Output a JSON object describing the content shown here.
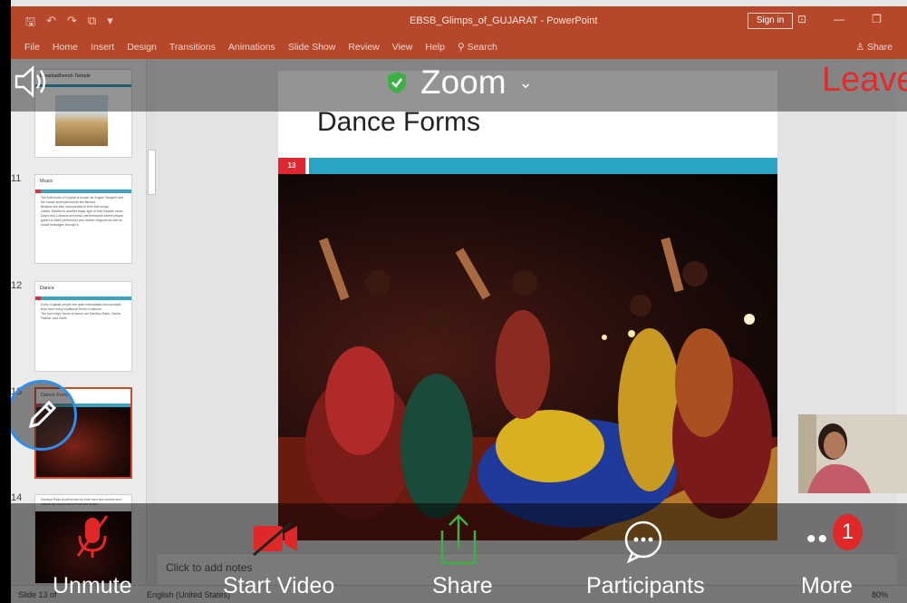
{
  "ppt": {
    "title": "EBSB_Glimps_of_GUJARAT - PowerPoint",
    "sign_in": "Sign in",
    "ribbon_tabs": [
      "File",
      "Home",
      "Insert",
      "Design",
      "Transitions",
      "Animations",
      "Slide Show",
      "Review",
      "View",
      "Help",
      "Search"
    ],
    "share": "Share",
    "notes_placeholder": "Click to add notes",
    "status_left": "Slide 13 of",
    "status_lang": "English (United States)",
    "zoom_level": "80%"
  },
  "thumbnails": [
    {
      "num": "",
      "title": "Dwarkadheesh Temple"
    },
    {
      "num": "11",
      "title": "Music",
      "lines": [
        "The folk music of Gujarat is known as Sugam Sangeet and the vocals and instruments are famous.",
        "Bhajans are also incorporated in their folk songs.",
        "Garba, Haldhin is another major type of folk Gujarati music.",
        "Dayro and Lokvarta are music performances where people gather to listen performers who deliver religious as well as social messages through it."
      ]
    },
    {
      "num": "12",
      "title": "Dance",
      "lines": [
        "Every Gujarati people are quite enthusiastic and sociable, thus have many traditional forms of dances.",
        "The four major forms of dance are Dandiya Raas, Garba, Padhar, and Garbi."
      ]
    },
    {
      "num": "13",
      "title": "Dance Forms"
    },
    {
      "num": "14",
      "title": "Dandiya Raas is performed by both men and women and reflects the movement of feminine charm..."
    }
  ],
  "slide": {
    "title": "Dance Forms",
    "number": "13"
  },
  "zoom": {
    "app_name": "Zoom",
    "leave": "Leave",
    "controls": {
      "unmute": "Unmute",
      "start_video": "Start Video",
      "share": "Share",
      "participants": "Participants",
      "more": "More"
    },
    "more_badge": "1"
  },
  "colors": {
    "ppt_accent": "#b7472a",
    "zoom_leave": "#e52a2a",
    "muted_red": "#e02828",
    "share_green": "#3cb043",
    "pen_ring": "#2e8ff0"
  }
}
